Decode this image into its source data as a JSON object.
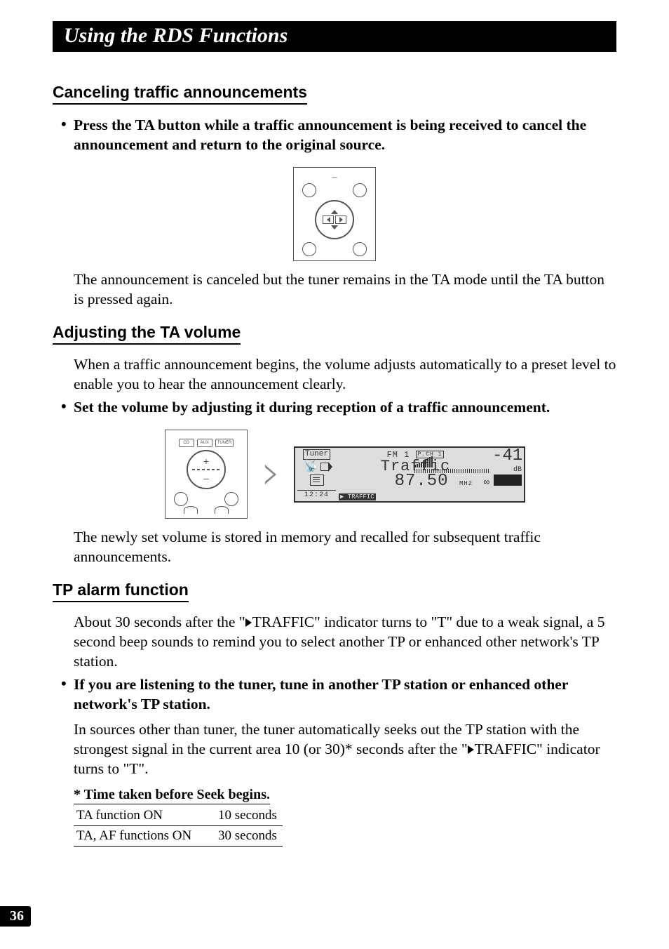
{
  "page": {
    "title_bar": "Using the RDS Functions",
    "page_number": "36"
  },
  "sections": {
    "s1": {
      "heading": "Canceling traffic announcements",
      "bullet1": "Press the TA button while a traffic announcement is being received to cancel the announcement and return to the original source.",
      "para1": "The announcement is canceled but the tuner remains in the TA mode until the TA button is pressed again."
    },
    "s2": {
      "heading": "Adjusting the TA volume",
      "para1": "When a traffic announcement begins, the volume adjusts automatically to a preset level to enable you to hear the announcement clearly.",
      "bullet1": "Set the volume by adjusting it during reception of a traffic announcement.",
      "para2": "The newly set volume is stored in memory and recalled for subsequent traffic announcements."
    },
    "s3": {
      "heading": "TP alarm function",
      "para1_a": "About 30 seconds after the \"",
      "para1_b": "TRAFFIC\" indicator turns to \"T\" due to a weak signal, a 5 second beep sounds to remind you to select another TP or enhanced other network's TP station.",
      "bullet1": "If you are listening to the tuner, tune in another TP station or enhanced other network's TP station.",
      "para2_a": "In sources other than tuner, the tuner automatically seeks out the TP station with the strongest signal in the current area 10 (or 30)*  seconds after the \"",
      "para2_b": "TRAFFIC\" indicator turns to \"T\".",
      "footnote_heading": "* Time taken before Seek begins.",
      "table": {
        "r1c1": "TA function ON",
        "r1c2": "10 seconds",
        "r2c1": "TA, AF functions ON",
        "r2c2": "30 seconds"
      }
    }
  },
  "device": {
    "btn_cd": "CD",
    "btn_aux": "AUX",
    "btn_tuner": "TUNER",
    "dash": "–",
    "plus": "+",
    "minus": "–"
  },
  "lcd": {
    "tuner": "Tuner",
    "time": "12:24",
    "fm": "FM 1",
    "pch": "P.CH 1",
    "traffic": "Traffic",
    "freq": "87.50",
    "mhz": "MHz",
    "stereo": "∞",
    "footer": "▶ TRAFFIC",
    "level": "-41",
    "db": "dB"
  }
}
